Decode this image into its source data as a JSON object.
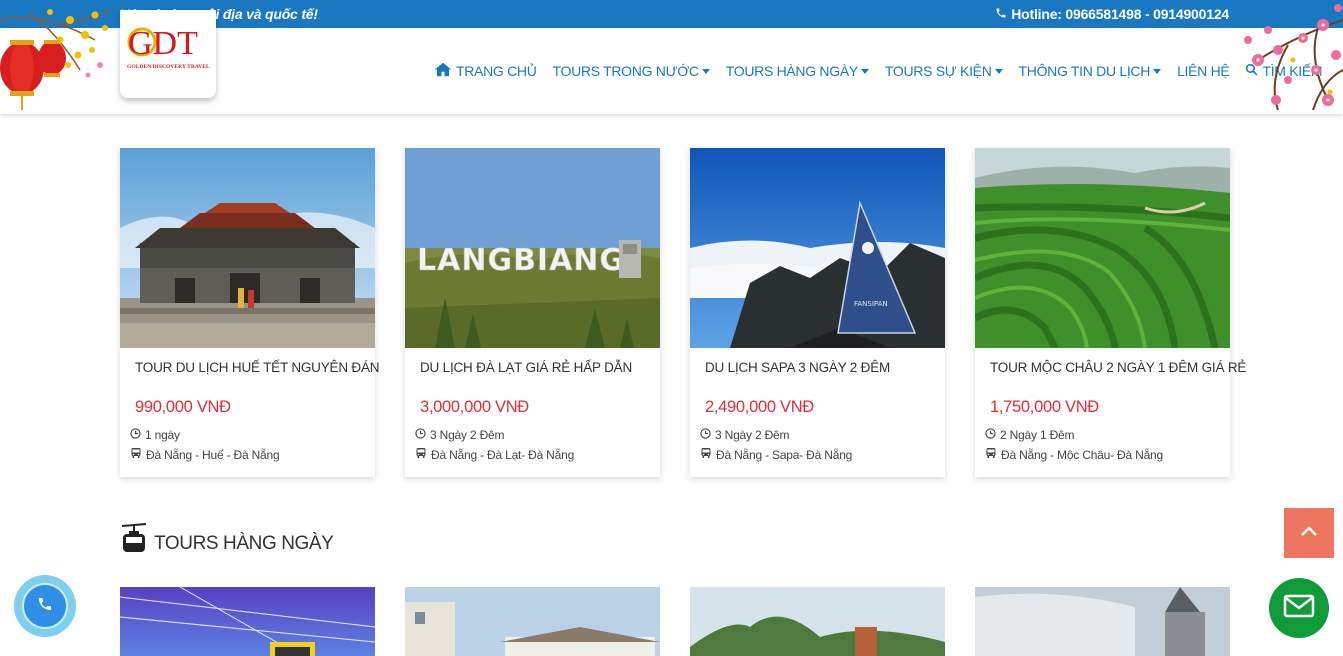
{
  "topbar": {
    "promo": "Vé máy bay nội địa và quốc tế!",
    "hotline": "Hotline: 0966581498 - 0914900124"
  },
  "logo": {
    "text": "GDT",
    "subtitle": "GOLDEN DISCOVERY TRAVEL"
  },
  "nav": {
    "items": [
      {
        "label": "TRANG CHỦ",
        "icon": "home-icon",
        "dropdown": false
      },
      {
        "label": "TOURS TRONG NƯỚC",
        "dropdown": true
      },
      {
        "label": "TOURS HÀNG NGÀY",
        "dropdown": true
      },
      {
        "label": "TOURS SỰ KIỆN",
        "dropdown": true
      },
      {
        "label": "THÔNG TIN DU LỊCH",
        "dropdown": true
      },
      {
        "label": "LIÊN HỆ",
        "dropdown": false
      },
      {
        "label": "TÌM KIẾM",
        "icon": "search-icon",
        "dropdown": false
      }
    ]
  },
  "tours": [
    {
      "title": "TOUR DU LỊCH HUẾ TẾT NGUYÊN ĐÁN",
      "price": "990,000 VNĐ",
      "duration": "1 ngày",
      "route": "Đà Nẵng - Huế - Đà Nẵng"
    },
    {
      "title": "DU LỊCH ĐÀ LẠT GIÁ RẺ HẤP DẪN",
      "price": "3,000,000 VNĐ",
      "duration": "3 Ngày 2 Đêm",
      "route": "Đà Nẵng - Đà Lạt- Đà Nẵng"
    },
    {
      "title": "DU LỊCH SAPA 3 NGÀY 2 ĐÊM",
      "price": "2,490,000 VNĐ",
      "duration": "3 Ngày 2 Đêm",
      "route": "Đà Nẵng - Sapa- Đà Nẵng"
    },
    {
      "title": "TOUR MỘC CHÂU 2 NGÀY 1 ĐÊM GIÁ RẺ",
      "price": "1,750,000 VNĐ",
      "duration": "2 Ngày 1 Đêm",
      "route": "Đà Nẵng - Mộc Châu- Đà Nẵng"
    }
  ],
  "image_text": {
    "langbiang": "LANGBIANG",
    "fansipan": "FANSIPAN"
  },
  "section": {
    "title": "TOURS HÀNG NGÀY",
    "icon": "cable-car-icon"
  },
  "colors": {
    "primary": "#1a78c2",
    "price": "#e02f3a",
    "scroll_top": "#ee7560",
    "mail": "#119a3a",
    "call": "#2f8ee6"
  }
}
